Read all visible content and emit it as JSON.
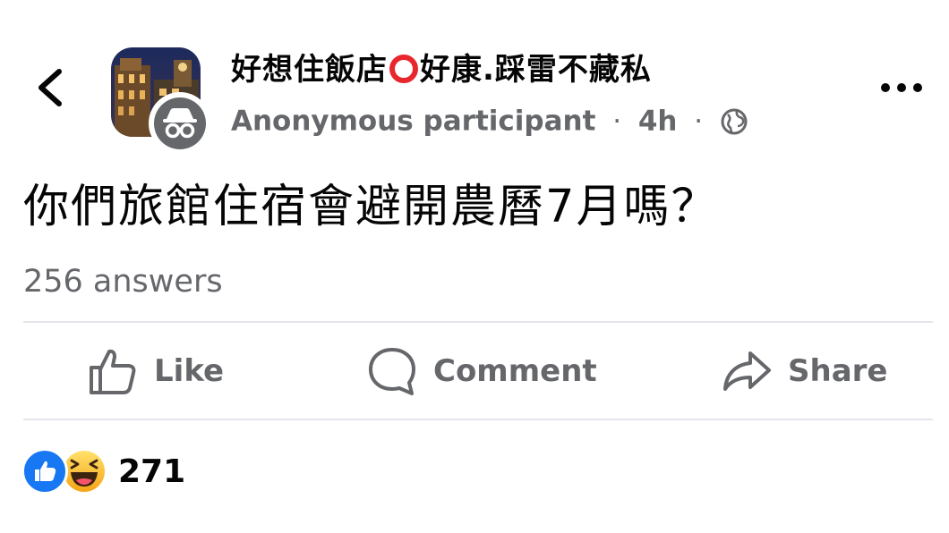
{
  "header": {
    "group_name_part1": "好想住飯店",
    "group_name_part2": "好康.踩雷不藏私",
    "author": "Anonymous participant",
    "separator": "·",
    "time": "4h",
    "icons": [
      "back-chevron-icon",
      "anonymous-icon",
      "globe-icon",
      "more-icon"
    ]
  },
  "post": {
    "question": "你們旅館住宿會避開農曆7月嗎？",
    "answers": "256 answers"
  },
  "actions": {
    "like": "Like",
    "comment": "Comment",
    "share": "Share"
  },
  "reactions": {
    "count": "271",
    "types": [
      "like",
      "haha"
    ]
  },
  "colors": {
    "brand_blue": "#1877f2",
    "secondary_text": "#65676b",
    "ring_red": "#e8272d",
    "divider": "#e4e6eb"
  }
}
